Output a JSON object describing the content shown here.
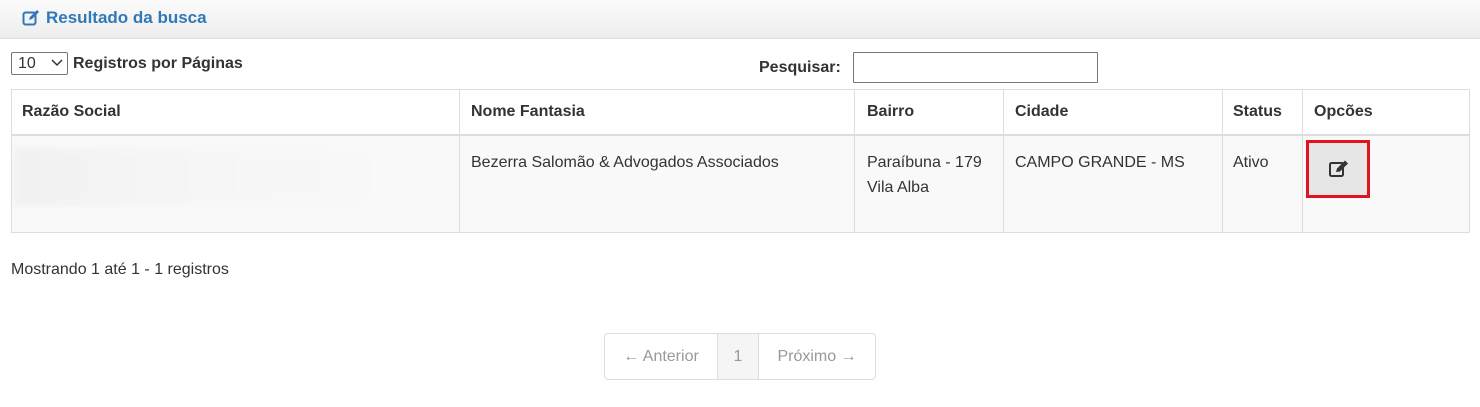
{
  "panel": {
    "title": "Resultado da busca",
    "icon": "edit-square-icon"
  },
  "controls": {
    "page_length": "10",
    "page_length_label": "Registros por Páginas",
    "search_label": "Pesquisar:",
    "search_value": ""
  },
  "table": {
    "columns": [
      "Razão Social",
      "Nome Fantasia",
      "Bairro",
      "Cidade",
      "Status",
      "Opcões"
    ],
    "rows": [
      {
        "razao_social": "",
        "nome_fantasia": "Bezerra Salomão & Advogados Associados",
        "bairro_line1": "Paraíbuna - 179",
        "bairro_line2": "Vila Alba",
        "cidade": "CAMPO GRANDE - MS",
        "status": "Ativo",
        "action_icon": "edit-icon"
      }
    ]
  },
  "info": "Mostrando 1 até 1 - 1 registros",
  "pagination": {
    "prev": "← Anterior",
    "current": "1",
    "next": "Próximo →"
  },
  "colors": {
    "title": "#3178b8",
    "highlight": "#e0141e",
    "row_bg": "#f9f9f9"
  }
}
